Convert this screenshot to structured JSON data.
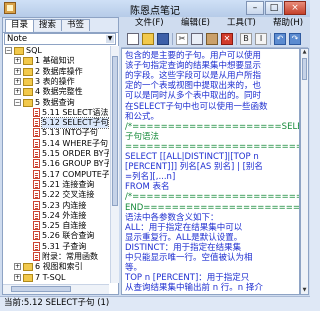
{
  "window": {
    "title": "陈恩点笔记",
    "min": "–",
    "max": "□",
    "close": "×"
  },
  "left_tabs": [
    "目录",
    "搜索",
    "书签"
  ],
  "note_selector": {
    "value": "Note"
  },
  "tree": [
    {
      "label": "SQL",
      "kind": "folder",
      "level": 0,
      "expanded": true
    },
    {
      "label": "1 基础知识",
      "kind": "folder",
      "level": 1,
      "expanded": false
    },
    {
      "label": "2 数据库操作",
      "kind": "folder",
      "level": 1,
      "expanded": false
    },
    {
      "label": "3 表的操作",
      "kind": "folder",
      "level": 1,
      "expanded": false
    },
    {
      "label": "4 数据完整性",
      "kind": "folder",
      "level": 1,
      "expanded": false
    },
    {
      "label": "5 数据查询",
      "kind": "folder",
      "level": 1,
      "expanded": true
    },
    {
      "label": "5.11 SELECT语法",
      "kind": "doc",
      "level": 2
    },
    {
      "label": "5.12 SELECT子句",
      "kind": "doc",
      "level": 2,
      "selected": true
    },
    {
      "label": "5.13 INTO子句",
      "kind": "doc",
      "level": 2
    },
    {
      "label": "5.14 WHERE子句",
      "kind": "doc",
      "level": 2
    },
    {
      "label": "5.15 ORDER BY子",
      "kind": "doc",
      "level": 2
    },
    {
      "label": "5.16 GROUP BY子",
      "kind": "doc",
      "level": 2
    },
    {
      "label": "5.17 COMPUTE子句",
      "kind": "doc",
      "level": 2
    },
    {
      "label": "5.21 连接查询",
      "kind": "doc",
      "level": 2
    },
    {
      "label": "5.22 交叉连接",
      "kind": "doc",
      "level": 2
    },
    {
      "label": "5.23 内连接",
      "kind": "doc",
      "level": 2
    },
    {
      "label": "5.24 外连接",
      "kind": "doc",
      "level": 2
    },
    {
      "label": "5.25 自连接",
      "kind": "doc",
      "level": 2
    },
    {
      "label": "5.26 联合查询",
      "kind": "doc",
      "level": 2
    },
    {
      "label": "5.31 子查询",
      "kind": "doc",
      "level": 2
    },
    {
      "label": "附录：常用函数",
      "kind": "doc",
      "level": 2
    },
    {
      "label": "6 视图和索引",
      "kind": "folder",
      "level": 1,
      "expanded": false
    },
    {
      "label": "7 T-SQL",
      "kind": "folder",
      "level": 1,
      "expanded": false
    }
  ],
  "menu": [
    "文件(F)",
    "编辑(E)",
    "工具(T)",
    "帮助(H)"
  ],
  "toolbar_icons": [
    "new-icon",
    "open-icon",
    "save-icon",
    "cut-icon",
    "copy-icon",
    "paste-icon",
    "delete-icon",
    "bold-icon",
    "italic-icon",
    "undo-icon",
    "redo-icon"
  ],
  "editor_lines": [
    {
      "t": "包含的是主要的子句。用户可以使用",
      "c": "blue"
    },
    {
      "t": "该子句指定查询的结果集中想要显示",
      "c": "blue"
    },
    {
      "t": "的字段。这些字段可以是从用户所指",
      "c": "blue"
    },
    {
      "t": "定的一个表或视图中提取出来的，也",
      "c": "blue"
    },
    {
      "t": "可以是同时从多个表中取出的。同时",
      "c": "blue"
    },
    {
      "t": "在SELECT子句中也可以使用一些函数",
      "c": "blue"
    },
    {
      "t": "和公式。",
      "c": "blue"
    },
    {
      "t": "/*=====================SELECT",
      "c": "green"
    },
    {
      "t": "子句语法",
      "c": "green"
    },
    {
      "t": "=============================*/",
      "c": "green"
    },
    {
      "t": "SELECT [[ALL|DISTINCT]|[TOP n",
      "c": "blue"
    },
    {
      "t": "[PERCENT]]] 列名[AS 别名] | [别名",
      "c": "blue"
    },
    {
      "t": "=列名][,...n]",
      "c": "blue"
    },
    {
      "t": "FROM 表名",
      "c": "blue"
    },
    {
      "t": "/*===========================THE",
      "c": "green"
    },
    {
      "t": "END==========================*/",
      "c": "green"
    },
    {
      "t": "语法中各参数含义如下：",
      "c": "blue"
    },
    {
      "t": "     ALL：用于指定在结果集中可以",
      "c": "blue"
    },
    {
      "t": "显示重复行。ALL是默认设置。",
      "c": "blue"
    },
    {
      "t": "     DISTINCT：用于指定在结果集",
      "c": "blue"
    },
    {
      "t": "中只能显示唯一行。空值被认为相",
      "c": "blue"
    },
    {
      "t": "等。",
      "c": "blue"
    },
    {
      "t": "     TOP n [PERCENT]：用于指定只",
      "c": "blue"
    },
    {
      "t": "从查询结果集中输出前 n 行。n 择介",
      "c": "blue"
    }
  ],
  "status": {
    "text": "当前:5.12 SELECT子句 (1)"
  }
}
